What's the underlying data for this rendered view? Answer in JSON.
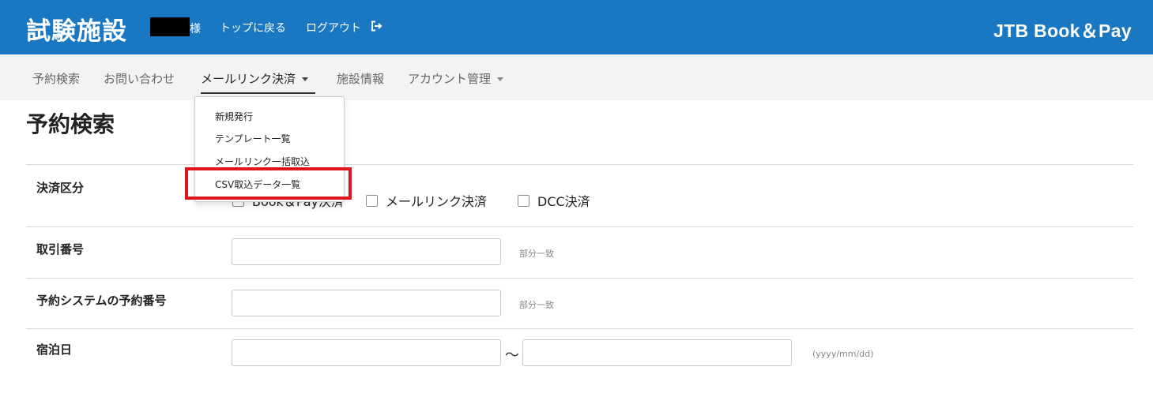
{
  "header": {
    "facility_name": "試験施設",
    "honorific": "様",
    "top_link": "トップに戻る",
    "logout": "ログアウト",
    "brand": "JTB Book＆Pay",
    "bg_color": "#1a78c2"
  },
  "nav": {
    "items": [
      {
        "label": "予約検索"
      },
      {
        "label": "お問い合わせ"
      },
      {
        "label": "メールリンク決済"
      },
      {
        "label": "施設情報"
      },
      {
        "label": "アカウント管理"
      }
    ]
  },
  "dropdown": {
    "items": [
      {
        "label": "新規発行"
      },
      {
        "label": "テンプレート一覧"
      },
      {
        "label": "メールリンク一括取込"
      },
      {
        "label": "CSV取込データ一覧"
      }
    ],
    "highlight_color": "#e0141c"
  },
  "page": {
    "title": "予約検索"
  },
  "form": {
    "payment_type": {
      "label": "決済区分",
      "options": [
        {
          "label": "Book＆Pay決済"
        },
        {
          "label": "メールリンク決済"
        },
        {
          "label": "DCC決済"
        }
      ]
    },
    "transaction_no": {
      "label": "取引番号",
      "hint": "部分一致"
    },
    "booking_no": {
      "label": "予約システムの予約番号",
      "hint": "部分一致"
    },
    "stay_date": {
      "label": "宿泊日",
      "separator": "～",
      "hint": "(yyyy/mm/dd)"
    }
  }
}
